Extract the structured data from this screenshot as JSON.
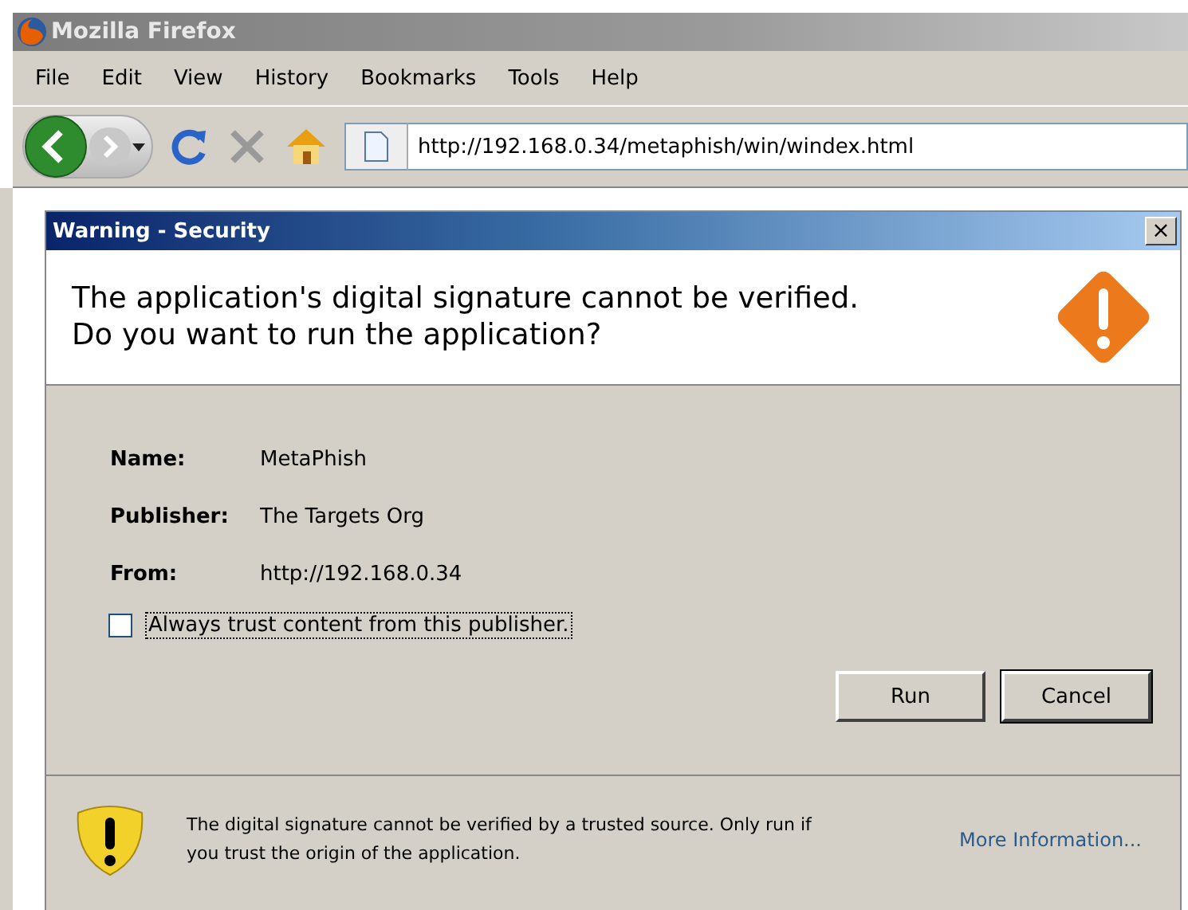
{
  "window": {
    "title": "Mozilla Firefox"
  },
  "menu": [
    "File",
    "Edit",
    "View",
    "History",
    "Bookmarks",
    "Tools",
    "Help"
  ],
  "address_bar": {
    "value": "http://192.168.0.34/metaphish/win/windex.html"
  },
  "dialog": {
    "title": "Warning - Security",
    "close": "×",
    "heading": [
      "The application's digital signature cannot be verified.",
      "Do you want to run the application?"
    ],
    "fields": [
      {
        "label": "Name:",
        "value": "MetaPhish"
      },
      {
        "label": "Publisher:",
        "value": "The Targets Org"
      },
      {
        "label": "From:",
        "value": "http://192.168.0.34"
      }
    ],
    "trust": {
      "label": "Always trust content from this publisher.",
      "checked": false
    },
    "buttons": [
      "Run",
      "Cancel"
    ],
    "footer": {
      "text": "The digital signature cannot be verified by a trusted source.  Only run if you trust the origin of the application.",
      "link": "More Information..."
    }
  }
}
